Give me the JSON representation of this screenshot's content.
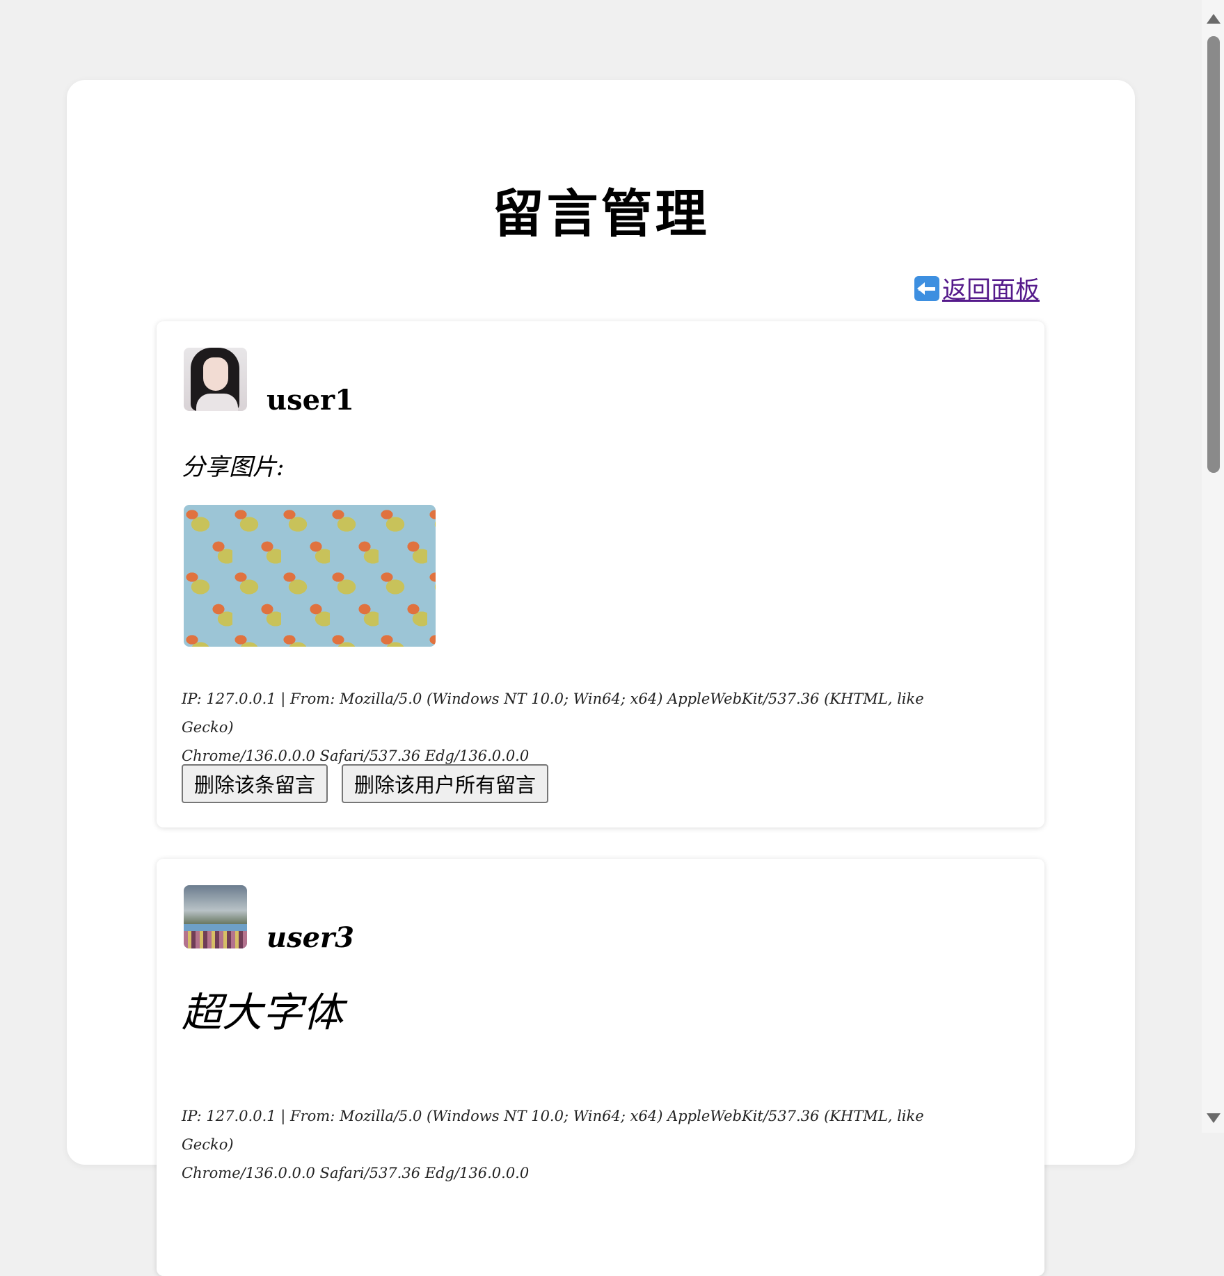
{
  "page": {
    "title": "留言管理",
    "back_link": "返回面板"
  },
  "messages": [
    {
      "username": "user1",
      "text": "分享图片:",
      "meta_line1": "IP: 127.0.0.1 | From: Mozilla/5.0 (Windows NT 10.0; Win64; x64) AppleWebKit/537.36 (KHTML, like Gecko)",
      "meta_line2": "Chrome/136.0.0.0 Safari/537.36 Edg/136.0.0.0",
      "delete_one_label": "删除该条留言",
      "delete_all_label": "删除该用户所有留言"
    },
    {
      "username": "user3",
      "text": "超大字体",
      "meta_line1": "IP: 127.0.0.1 | From: Mozilla/5.0 (Windows NT 10.0; Win64; x64) AppleWebKit/537.36 (KHTML, like Gecko)",
      "meta_line2": "Chrome/136.0.0.0 Safari/537.36 Edg/136.0.0.0"
    }
  ],
  "icons": {
    "back": "back-arrow-icon"
  }
}
